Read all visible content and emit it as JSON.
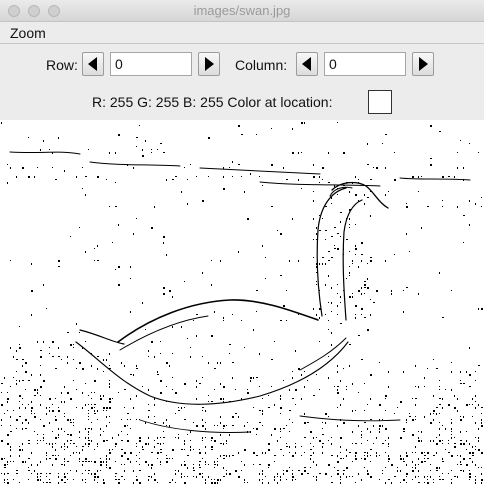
{
  "window": {
    "title": "images/swan.jpg"
  },
  "menu": {
    "items": [
      {
        "label": "Zoom"
      }
    ]
  },
  "controls": {
    "row_label": "Row:",
    "row_value": "0",
    "column_label": "Column:",
    "column_value": "0",
    "color_readout": "R: 255 G: 255 B: 255 Color at location:",
    "color_swatch": "#ffffff"
  },
  "icons": {
    "prev": "left-triangle-icon",
    "next": "right-triangle-icon"
  },
  "image": {
    "description_kind": "edge-detected picture of a swan on water",
    "background": "#ffffff",
    "ink": "#000000"
  }
}
